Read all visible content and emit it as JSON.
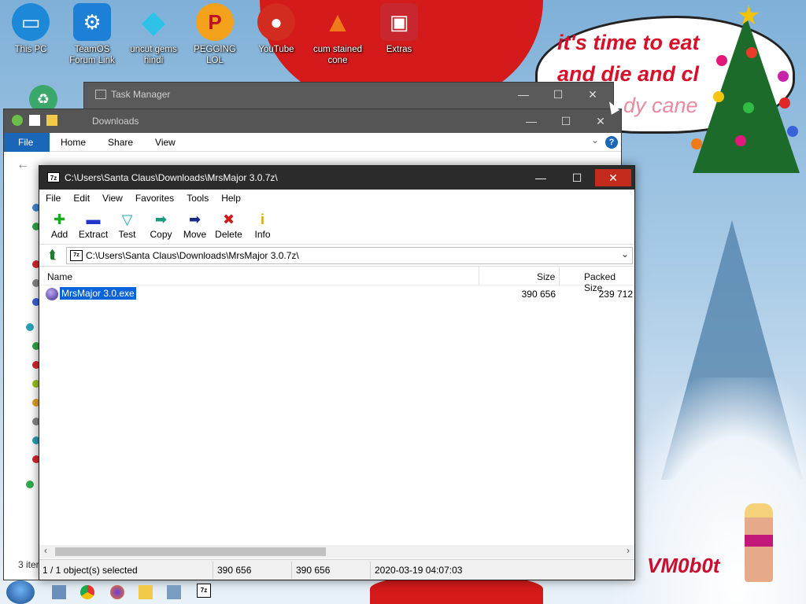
{
  "desktop": {
    "icons": [
      {
        "label": "This PC",
        "icon": "monitor-icon",
        "color": "#1e88d8"
      },
      {
        "label": "TeamOS Forum Link",
        "icon": "gear-icon",
        "color": "#1e7fd6"
      },
      {
        "label": "uncut gems hindi",
        "icon": "diamond-icon",
        "color": "#2fc2e8"
      },
      {
        "label": "PEGGING LOL",
        "icon": "letter-p-icon",
        "color": "#f3a11b"
      },
      {
        "label": "YouTube",
        "icon": "angry-bird-icon",
        "color": "#d22b1f"
      },
      {
        "label": "cum stained cone",
        "icon": "traffic-cone-icon",
        "color": "#f07a19"
      },
      {
        "label": "Extras",
        "icon": "gift-icon",
        "color": "#c9272f"
      }
    ],
    "speech_bubble": {
      "line1": "it's time to eat",
      "line2": "and die and cl",
      "line3": "dy cane"
    },
    "signature": "VM0b0t"
  },
  "task_manager": {
    "title": "Task Manager"
  },
  "explorer": {
    "title": "Downloads",
    "tabs": [
      "File",
      "Home",
      "Share",
      "View"
    ],
    "items_count": "3 iter"
  },
  "sevenzip": {
    "title": "C:\\Users\\Santa Claus\\Downloads\\MrsMajor 3.0.7z\\",
    "menu": [
      "File",
      "Edit",
      "View",
      "Favorites",
      "Tools",
      "Help"
    ],
    "toolbar": [
      {
        "label": "Add",
        "icon": "plus-icon",
        "color": "#1ea81e",
        "glyph": "✚"
      },
      {
        "label": "Extract",
        "icon": "minus-icon",
        "color": "#1f36c8",
        "glyph": "▬"
      },
      {
        "label": "Test",
        "icon": "check-icon",
        "color": "#1aa7b8",
        "glyph": "▽"
      },
      {
        "label": "Copy",
        "icon": "copy-arrow-icon",
        "color": "#1a9a7a",
        "glyph": "➡"
      },
      {
        "label": "Move",
        "icon": "move-arrow-icon",
        "color": "#1a2a8a",
        "glyph": "➡"
      },
      {
        "label": "Delete",
        "icon": "delete-x-icon",
        "color": "#d01a1a",
        "glyph": "✖"
      },
      {
        "label": "Info",
        "icon": "info-icon",
        "color": "#d8a800",
        "glyph": "i"
      }
    ],
    "path": "C:\\Users\\Santa Claus\\Downloads\\MrsMajor 3.0.7z\\",
    "columns": {
      "name": "Name",
      "size": "Size",
      "packed": "Packed Size"
    },
    "files": [
      {
        "name": "MrsMajor 3.0.exe",
        "size": "390 656",
        "packed": "239 712"
      }
    ],
    "status": {
      "selected": "1 / 1 object(s) selected",
      "size": "390 656",
      "total": "390 656",
      "date": "2020-03-19 04:07:03"
    }
  },
  "taskbar": {
    "app_label": "7z"
  }
}
